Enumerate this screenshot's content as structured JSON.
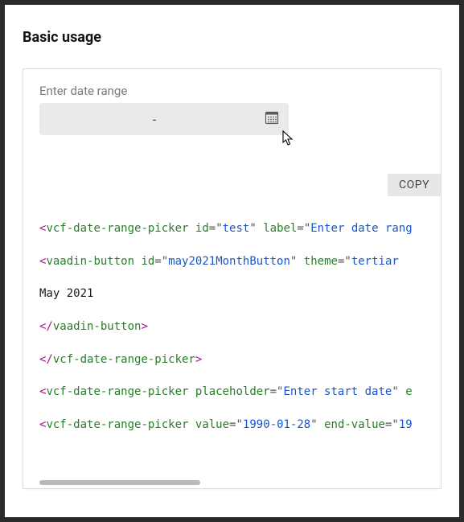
{
  "title": "Basic usage",
  "field": {
    "label": "Enter date range",
    "value": "-"
  },
  "copy_label": "COPY",
  "code": {
    "l1": {
      "tag": "vcf-date-range-picker",
      "a1n": "id",
      "a1v": "test",
      "a2n": "label",
      "a2v": "Enter date rang"
    },
    "l2": {
      "tag": "vaadin-button",
      "a1n": "id",
      "a1v": "may2021MonthButton",
      "a2n": "theme",
      "a2v": "tertiar"
    },
    "l3": {
      "text": "May 2021"
    },
    "l4": {
      "tag": "vaadin-button"
    },
    "l5": {
      "tag": "vcf-date-range-picker"
    },
    "l6": {
      "tag": "vcf-date-range-picker",
      "a1n": "placeholder",
      "a1v": "Enter start date",
      "a2n": "e"
    },
    "l7": {
      "tag": "vcf-date-range-picker",
      "a1n": "value",
      "a1v": "1990-01-28",
      "a2n": "end-value",
      "a2v": "19"
    }
  }
}
